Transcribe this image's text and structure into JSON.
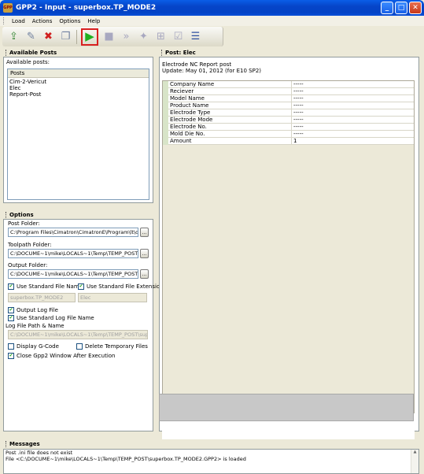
{
  "window": {
    "title": "GPP2 - Input - superbox.TP_MODE2",
    "app_badge": "GPP"
  },
  "menu": [
    "Load",
    "Actions",
    "Options",
    "Help"
  ],
  "toolbar": {
    "icons": [
      "load-post-icon",
      "edit-post-icon",
      "delete-post-icon",
      "copy-post-icon",
      "run-icon",
      "stop-icon",
      "step-icon",
      "debug-icon",
      "variables-icon",
      "checklist-icon",
      "output-icon"
    ]
  },
  "available_posts": {
    "title": "Available Posts",
    "label": "Available posts:",
    "column": "Posts",
    "items": [
      "Cim-2-Vericut",
      "Elec",
      "Report-Post"
    ]
  },
  "options": {
    "title": "Options",
    "post_folder_label": "Post Folder:",
    "post_folder": "C:\\Program Files\\Cimatron\\CimatronE\\Program\\lt\\dat",
    "toolpath_folder_label": "Toolpath Folder:",
    "toolpath_folder": "C:\\DOCUME~1\\mike\\LOCALS~1\\Temp\\TEMP_POST",
    "output_folder_label": "Output Folder:",
    "output_folder": "C:\\DOCUME~1\\mike\\LOCALS~1\\Temp\\TEMP_POST",
    "browse": "...",
    "use_std_file_name": "Use Standard File Name",
    "use_std_file_ext": "Use Standard File Extension",
    "file_name": "superbox.TP_MODE2",
    "file_ext": "Elec",
    "output_log": "Output Log File",
    "use_std_log_name": "Use Standard Log File Name",
    "log_path_label": "Log File Path & Name",
    "log_path": "C:\\DOCUME~1\\mike\\LOCALS~1\\Temp\\TEMP_POST\\superbo",
    "display_gcode": "Display G-Code",
    "delete_temp": "Delete Temporary Files",
    "close_after": "Close Gpp2 Window After Execution"
  },
  "post": {
    "title": "Post: Elec",
    "description": "Electrode NC Report post",
    "update": "Update: May 01, 2012 (for E10 SP2)",
    "rows": [
      {
        "name": "Company Name",
        "value": "-----"
      },
      {
        "name": "Reciever",
        "value": "-----"
      },
      {
        "name": "Model Name",
        "value": "-----"
      },
      {
        "name": "Product Name",
        "value": "-----"
      },
      {
        "name": "Electrode Type",
        "value": "-----"
      },
      {
        "name": "Electrode Mode",
        "value": "-----"
      },
      {
        "name": "Electrode No.",
        "value": "-----"
      },
      {
        "name": "Mold Die No.",
        "value": "-----"
      },
      {
        "name": "Amount",
        "value": "1"
      }
    ]
  },
  "messages": {
    "title": "Messages",
    "lines": [
      "Post .ini file does not exist",
      "File <C:\\DOCUME~1\\mike\\LOCALS~1\\Temp\\TEMP_POST\\superbox.TP_MODE2.GPP2> is loaded"
    ]
  }
}
